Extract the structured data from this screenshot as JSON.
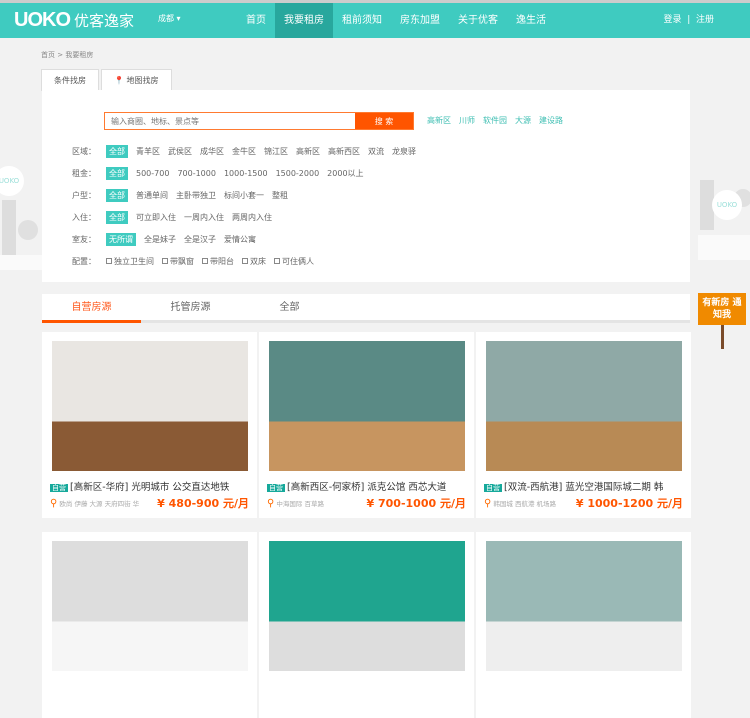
{
  "header": {
    "logo": "UOKO",
    "logo_cn": "优客逸家",
    "city": "成都 ▾",
    "nav": [
      "首页",
      "我要租房",
      "租前须知",
      "房东加盟",
      "关于优客",
      "逸生活"
    ],
    "login": "登录",
    "sep": "|",
    "register": "注册"
  },
  "breadcrumb": "首页 > 我要租房",
  "tabs": [
    "条件找房",
    "地图找房"
  ],
  "search": {
    "placeholder": "输入商圈、地标、景点等",
    "button": "搜 索",
    "hot": [
      "高新区",
      "川师",
      "软件园",
      "大源",
      "建设路"
    ]
  },
  "filters": [
    {
      "label": "区域：",
      "options": [
        "全部",
        "青羊区",
        "武侯区",
        "成华区",
        "金牛区",
        "锦江区",
        "高新区",
        "高新西区",
        "双流",
        "龙泉驿"
      ]
    },
    {
      "label": "租金：",
      "options": [
        "全部",
        "500-700",
        "700-1000",
        "1000-1500",
        "1500-2000",
        "2000以上"
      ]
    },
    {
      "label": "户型：",
      "options": [
        "全部",
        "普通单间",
        "主卧带独卫",
        "标间小套一",
        "整租"
      ]
    },
    {
      "label": "入住：",
      "options": [
        "全部",
        "可立即入住",
        "一周内入住",
        "两周内入住"
      ]
    },
    {
      "label": "室友：",
      "options": [
        "无所谓",
        "全是妹子",
        "全是汉子",
        "爱情公寓"
      ]
    }
  ],
  "config": {
    "label": "配置：",
    "options": [
      "独立卫生间",
      "带飘窗",
      "带阳台",
      "双床",
      "可住俩人"
    ]
  },
  "side_badge": "UOKO",
  "notify_sign": "有新房 通知我",
  "source_tabs": [
    "自营房源",
    "托管房源",
    "全部"
  ],
  "listings": [
    {
      "tag": "自营",
      "title": "[高新区-华府] 光明城市 公交直达地铁",
      "location": "欧尚 伊藤 大源 天府四街 华",
      "price": "¥ 480-900 元/月"
    },
    {
      "tag": "自营",
      "title": "[高新西区-何家桥] 派克公馆 西芯大道",
      "location": "中海国际 百草路",
      "price": "¥ 700-1000 元/月"
    },
    {
      "tag": "自营",
      "title": "[双流-西航港] 蓝光空港国际城二期 韩",
      "location": "韩国城 西航港 机场路",
      "price": "¥ 1000-1200 元/月"
    }
  ]
}
